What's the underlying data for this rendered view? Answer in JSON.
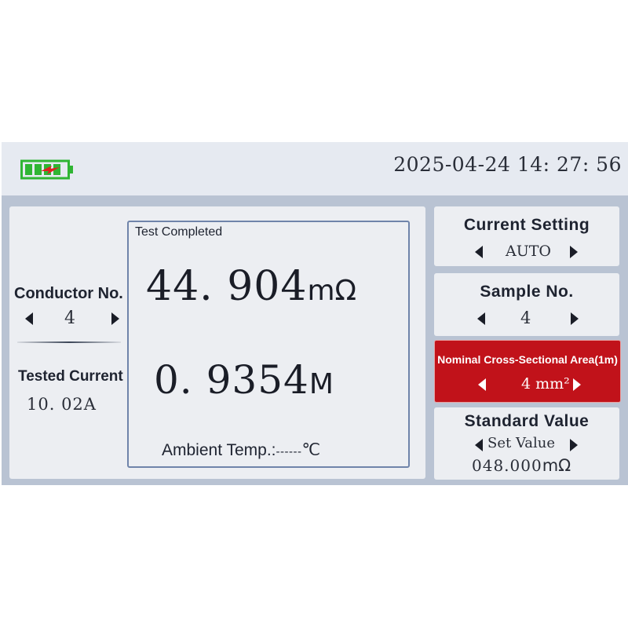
{
  "header": {
    "battery_icon": "battery-charging-icon",
    "datetime": "2025-04-24 14: 27: 56"
  },
  "left": {
    "conductor_label": "Conductor No.",
    "conductor_value": "4",
    "tested_current_label": "Tested Current",
    "tested_current_value": "10. 02A"
  },
  "main": {
    "status": "Test Completed",
    "resistance_value": "44. 904",
    "resistance_unit": "mΩ",
    "length_value": "0. 9354",
    "length_unit": "M",
    "ambient_label": "Ambient Temp.:",
    "ambient_value": "------",
    "ambient_unit": "℃"
  },
  "right": {
    "current_setting": {
      "title": "Current Setting",
      "value": "AUTO"
    },
    "sample_no": {
      "title": "Sample No.",
      "value": "4"
    },
    "cross_section": {
      "title": "Nominal Cross-Sectional Area(1m)",
      "value": "4 mm²"
    },
    "standard_value": {
      "title": "Standard Value",
      "setting": "Set Value",
      "value": "048.000",
      "unit": "mΩ"
    }
  },
  "colors": {
    "screen_bg": "#b9c3d3",
    "panel_bg": "#eceef2",
    "highlight": "#c1121a",
    "battery_green": "#2fb533",
    "charge_red": "#e02020"
  }
}
